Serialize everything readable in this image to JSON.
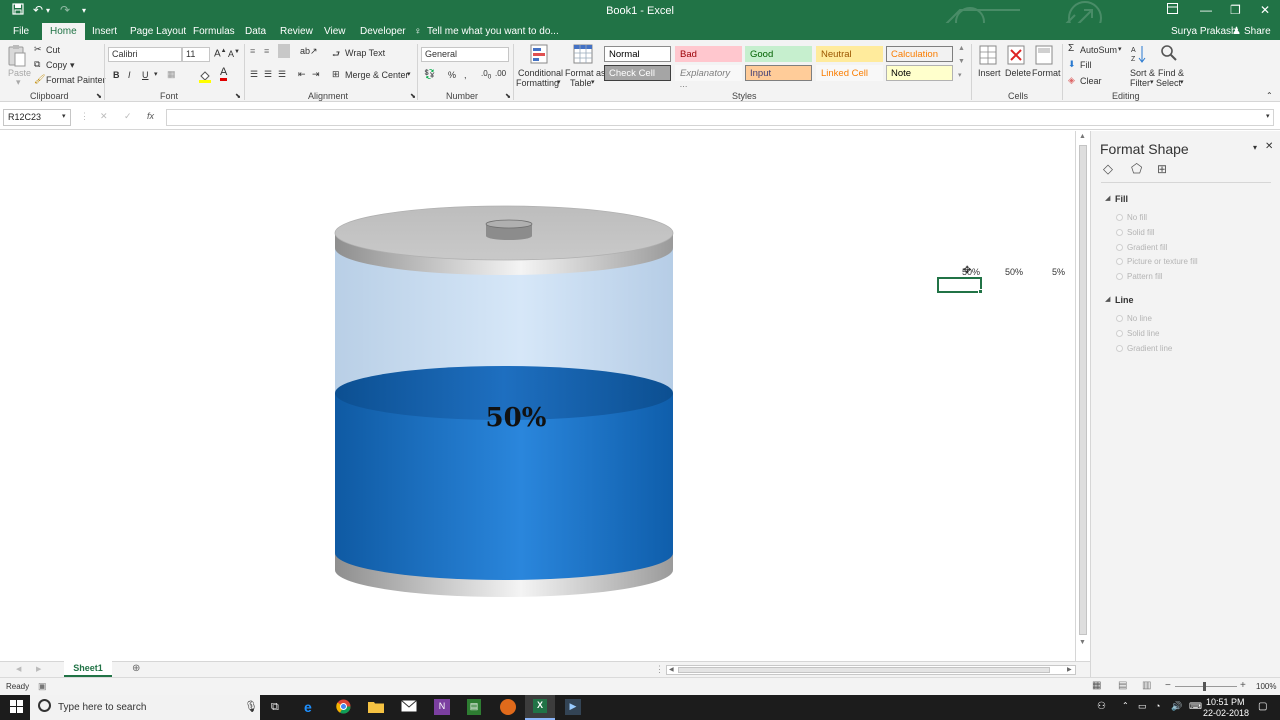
{
  "window": {
    "title": "Book1 - Excel",
    "user": "Surya Prakash",
    "share_label": "Share"
  },
  "tabs": [
    "File",
    "Home",
    "Insert",
    "Page Layout",
    "Formulas",
    "Data",
    "Review",
    "View",
    "Developer"
  ],
  "tell_me": "Tell me what you want to do...",
  "ribbon": {
    "clipboard": {
      "paste": "Paste",
      "cut": "Cut",
      "copy": "Copy",
      "format_painter": "Format Painter",
      "label": "Clipboard"
    },
    "font": {
      "name": "Calibri",
      "size": "11",
      "label": "Font"
    },
    "alignment": {
      "wrap": "Wrap Text",
      "merge": "Merge & Center",
      "label": "Alignment"
    },
    "number": {
      "format": "General",
      "label": "Number"
    },
    "styles": {
      "conditional": "Conditional",
      "conditional2": "Formatting",
      "format_as": "Format as",
      "table": "Table",
      "cells": [
        {
          "label": "Normal",
          "bg": "#ffffff",
          "fg": "#000000",
          "border": "#8c8c8c"
        },
        {
          "label": "Bad",
          "bg": "#ffc7ce",
          "fg": "#9c0006",
          "border": "#ffc7ce"
        },
        {
          "label": "Good",
          "bg": "#c6efce",
          "fg": "#006100",
          "border": "#c6efce"
        },
        {
          "label": "Neutral",
          "bg": "#ffeb9c",
          "fg": "#9c5700",
          "border": "#ffeb9c"
        },
        {
          "label": "Calculation",
          "bg": "#f2f2f2",
          "fg": "#fa7d00",
          "border": "#7f7f7f"
        },
        {
          "label": "Check Cell",
          "bg": "#a5a5a5",
          "fg": "#ffffff",
          "border": "#3f3f3f"
        },
        {
          "label": "Explanatory ...",
          "bg": "#f8f8f8",
          "fg": "#7f7f7f",
          "border": "#f8f8f8"
        },
        {
          "label": "Input",
          "bg": "#ffcc99",
          "fg": "#3f3f76",
          "border": "#7f7f7f"
        },
        {
          "label": "Linked Cell",
          "bg": "#f8f8f8",
          "fg": "#fa7d00",
          "border": "#f8f8f8"
        },
        {
          "label": "Note",
          "bg": "#ffffcc",
          "fg": "#000000",
          "border": "#b2b2b2"
        }
      ],
      "label": "Styles"
    },
    "cells": {
      "insert": "Insert",
      "delete": "Delete",
      "format": "Format",
      "label": "Cells"
    },
    "editing": {
      "autosum": "AutoSum",
      "fill": "Fill",
      "clear": "Clear",
      "sort": "Sort &",
      "filter": "Filter",
      "find": "Find &",
      "select": "Select",
      "label": "Editing"
    }
  },
  "formula_bar": {
    "name_box": "R12C23",
    "fx": "fx",
    "content": ""
  },
  "sheet": {
    "battery_label": "50%",
    "battery_level_percent": 50,
    "cells": [
      "50%",
      "50%",
      "5%"
    ]
  },
  "pane": {
    "title": "Format Shape",
    "fill_header": "Fill",
    "fill_options": [
      "No fill",
      "Solid fill",
      "Gradient fill",
      "Picture or texture fill",
      "Pattern fill"
    ],
    "line_header": "Line",
    "line_options": [
      "No line",
      "Solid line",
      "Gradient line"
    ]
  },
  "sheet_tab": "Sheet1",
  "status": {
    "ready": "Ready",
    "zoom": "100%"
  },
  "taskbar": {
    "search_placeholder": "Type here to search",
    "time": "10:51 PM",
    "date": "22-02-2018"
  },
  "colors": {
    "excel_green": "#217346",
    "battery_blue": "#1b74c7"
  }
}
